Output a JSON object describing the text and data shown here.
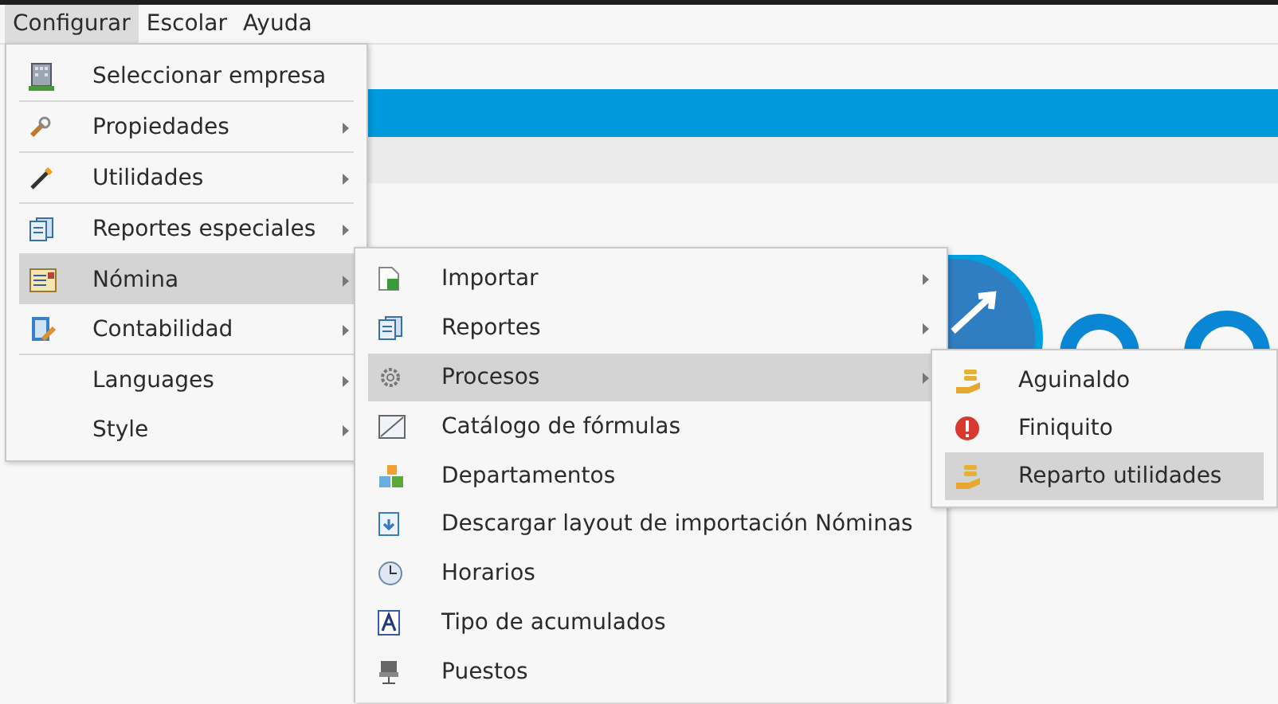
{
  "menubar": [
    {
      "label": "Configurar",
      "selected": true
    },
    {
      "label": "Escolar",
      "selected": false
    },
    {
      "label": "Ayuda",
      "selected": false
    }
  ],
  "menus": [
    {
      "items": [
        {
          "label": "Seleccionar empresa",
          "submenu": false,
          "selected": false,
          "divider_below": true
        },
        {
          "label": "Propiedades",
          "submenu": true,
          "selected": false,
          "divider_below": true
        },
        {
          "label": "Utilidades",
          "submenu": true,
          "selected": false,
          "divider_below": true
        },
        {
          "label": "Reportes especiales",
          "submenu": true,
          "selected": false,
          "divider_below": true
        },
        {
          "label": "Nómina",
          "submenu": true,
          "selected": true,
          "divider_below": false
        },
        {
          "label": "Contabilidad",
          "submenu": true,
          "selected": false,
          "divider_below": true
        },
        {
          "label": "Languages",
          "submenu": true,
          "selected": false,
          "divider_below": false
        },
        {
          "label": "Style",
          "submenu": true,
          "selected": false,
          "divider_below": false
        }
      ]
    },
    {
      "items": [
        {
          "label": "Importar",
          "submenu": true,
          "selected": false,
          "divider_below": false
        },
        {
          "label": "Reportes",
          "submenu": true,
          "selected": false,
          "divider_below": false
        },
        {
          "label": "Procesos",
          "submenu": true,
          "selected": true,
          "divider_below": false
        },
        {
          "label": "Catálogo de fórmulas",
          "submenu": false,
          "selected": false,
          "divider_below": false
        },
        {
          "label": "Departamentos",
          "submenu": false,
          "selected": false,
          "divider_below": false
        },
        {
          "label": "Descargar layout de importación Nóminas",
          "submenu": false,
          "selected": false,
          "divider_below": false
        },
        {
          "label": "Horarios",
          "submenu": false,
          "selected": false,
          "divider_below": false
        },
        {
          "label": "Tipo de acumulados",
          "submenu": false,
          "selected": false,
          "divider_below": false
        },
        {
          "label": "Puestos",
          "submenu": false,
          "selected": false,
          "divider_below": false
        }
      ]
    },
    {
      "items": [
        {
          "label": "Aguinaldo",
          "submenu": false,
          "selected": false,
          "divider_below": false
        },
        {
          "label": "Finiquito",
          "submenu": false,
          "selected": false,
          "divider_below": false
        },
        {
          "label": "Reparto utilidades",
          "submenu": false,
          "selected": true,
          "divider_below": false
        }
      ]
    }
  ]
}
